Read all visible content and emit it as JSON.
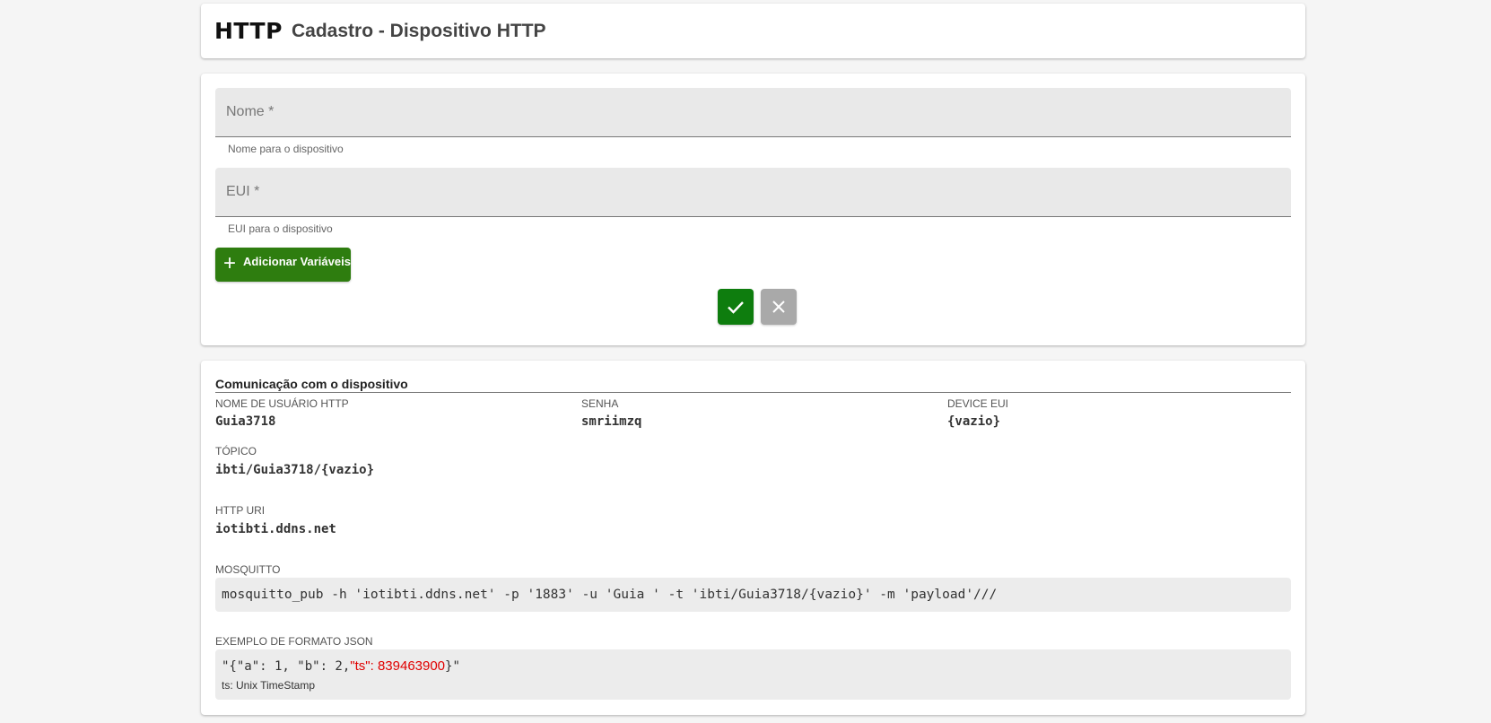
{
  "header": {
    "logo_text": "HTTP",
    "title": "Cadastro - Dispositivo HTTP"
  },
  "form": {
    "name_field": {
      "placeholder": "Nome *",
      "value": "",
      "hint": "Nome para o dispositivo"
    },
    "eui_field": {
      "placeholder": "EUI *",
      "value": "",
      "hint": "EUI para o dispositivo"
    },
    "add_variables_label": "Adicionar Variáveis",
    "accent_color": "#2e7d0f",
    "confirm_icon": "check-icon",
    "cancel_icon": "close-icon"
  },
  "info": {
    "section_title": "Comunicação com o dispositivo",
    "username_label": "NOME DE USUÁRIO HTTP",
    "username_value": "Guia3718",
    "password_label": "SENHA",
    "password_value": "smriimzq",
    "device_eui_label": "DEVICE EUI",
    "device_eui_value": "{vazio}",
    "topic_label": "TÓPICO",
    "topic_value": "ibti/Guia3718/{vazio}",
    "uri_label": "HTTP URI",
    "uri_value": "iotibti.ddns.net",
    "mosquitto_label": "MOSQUITTO",
    "mosquitto_command": "mosquitto_pub -h 'iotibti.ddns.net' -p '1883' -u 'Guia ' -t 'ibti/Guia3718/{vazio}' -m 'payload'///",
    "json_label": "EXEMPLO DE FORMATO JSON",
    "json_prefix": "\"{\"a\": 1, \"b\": 2,",
    "json_ts": "\"ts\": 839463900",
    "json_suffix": "}\"",
    "json_note": "ts: Unix TimeStamp"
  }
}
